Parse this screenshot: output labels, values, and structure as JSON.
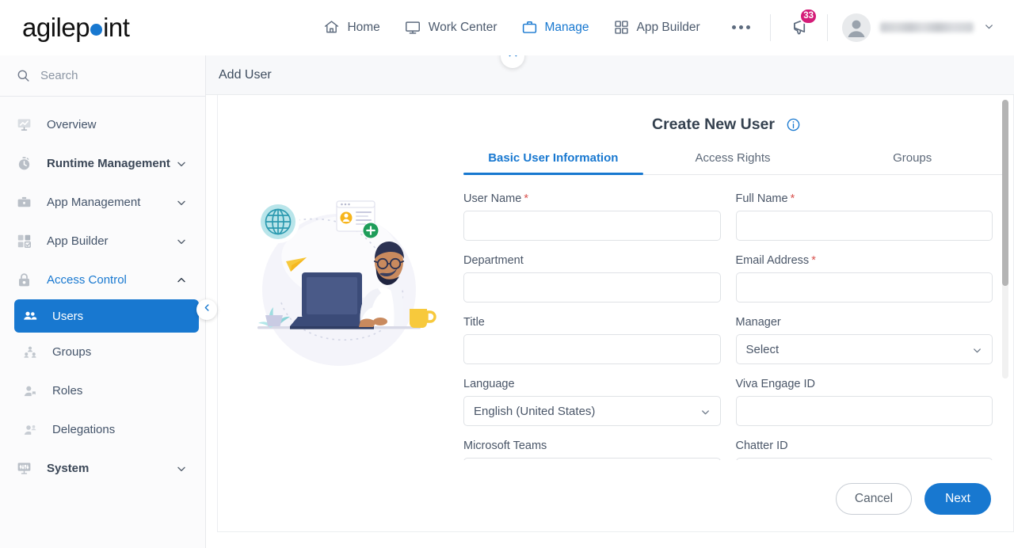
{
  "brand": {
    "name_before": "agilep",
    "name_after": "int",
    "dot_color": "#1878d0"
  },
  "topnav": {
    "items": [
      {
        "label": "Home",
        "icon": "home-icon",
        "active": false
      },
      {
        "label": "Work Center",
        "icon": "monitor-icon",
        "active": false
      },
      {
        "label": "Manage",
        "icon": "briefcase-icon",
        "active": true
      },
      {
        "label": "App Builder",
        "icon": "grid-icon",
        "active": false
      }
    ],
    "overflow": "more-options-icon",
    "announcement": {
      "icon": "megaphone-icon",
      "badge": "33",
      "badge_color": "#d41c78"
    },
    "user": {
      "avatar": "user-avatar",
      "name": "",
      "chevron": "chevron-down-icon"
    }
  },
  "sidebar": {
    "search": {
      "placeholder": "Search",
      "value": "",
      "icon": "search-icon"
    },
    "items": [
      {
        "label": "Overview",
        "icon": "overview-chart-icon",
        "expandable": false
      },
      {
        "label": "Runtime Management",
        "icon": "stopwatch-icon",
        "expandable": true,
        "chevron": "chevron-down-icon"
      },
      {
        "label": "App Management",
        "icon": "briefcase-icon",
        "expandable": true,
        "chevron": "chevron-down-icon"
      },
      {
        "label": "App Builder",
        "icon": "grid-check-icon",
        "expandable": true,
        "chevron": "chevron-down-icon"
      },
      {
        "label": "Access Control",
        "icon": "lock-icon",
        "expandable": true,
        "chevron": "chevron-up-icon",
        "active": true
      }
    ],
    "subitems": [
      {
        "label": "Users",
        "icon": "users-icon",
        "selected": true
      },
      {
        "label": "Groups",
        "icon": "group-tree-icon",
        "selected": false
      },
      {
        "label": "Roles",
        "icon": "role-user-icon",
        "selected": false
      },
      {
        "label": "Delegations",
        "icon": "delegation-icon",
        "selected": false
      }
    ],
    "footer_item": {
      "label": "System",
      "icon": "system-icon",
      "chevron": "chevron-down-icon"
    },
    "collapse": "collapse-sidebar-chevron-left-icon"
  },
  "panel": {
    "header_title": "Add User",
    "collapse_up": "chevron-up-icon"
  },
  "form": {
    "title": "Create New User",
    "info_icon": "info-icon",
    "tabs": [
      {
        "label": "Basic User Information",
        "active": true
      },
      {
        "label": "Access Rights",
        "active": false
      },
      {
        "label": "Groups",
        "active": false
      }
    ],
    "fields": [
      {
        "label": "User Name",
        "required": true,
        "type": "text",
        "value": ""
      },
      {
        "label": "Full Name",
        "required": true,
        "type": "text",
        "value": ""
      },
      {
        "label": "Department",
        "required": false,
        "type": "text",
        "value": ""
      },
      {
        "label": "Email Address",
        "required": true,
        "type": "text",
        "value": ""
      },
      {
        "label": "Title",
        "required": false,
        "type": "text",
        "value": ""
      },
      {
        "label": "Manager",
        "required": false,
        "type": "select",
        "value": "Select"
      },
      {
        "label": "Language",
        "required": false,
        "type": "select",
        "value": "English (United States)"
      },
      {
        "label": "Viva Engage ID",
        "required": false,
        "type": "text",
        "value": ""
      },
      {
        "label": "Microsoft Teams",
        "required": false,
        "type": "text",
        "value": ""
      },
      {
        "label": "Chatter ID",
        "required": false,
        "type": "text",
        "value": ""
      }
    ],
    "buttons": {
      "cancel": "Cancel",
      "next": "Next"
    }
  },
  "illustration": "user-at-laptop-illustration"
}
